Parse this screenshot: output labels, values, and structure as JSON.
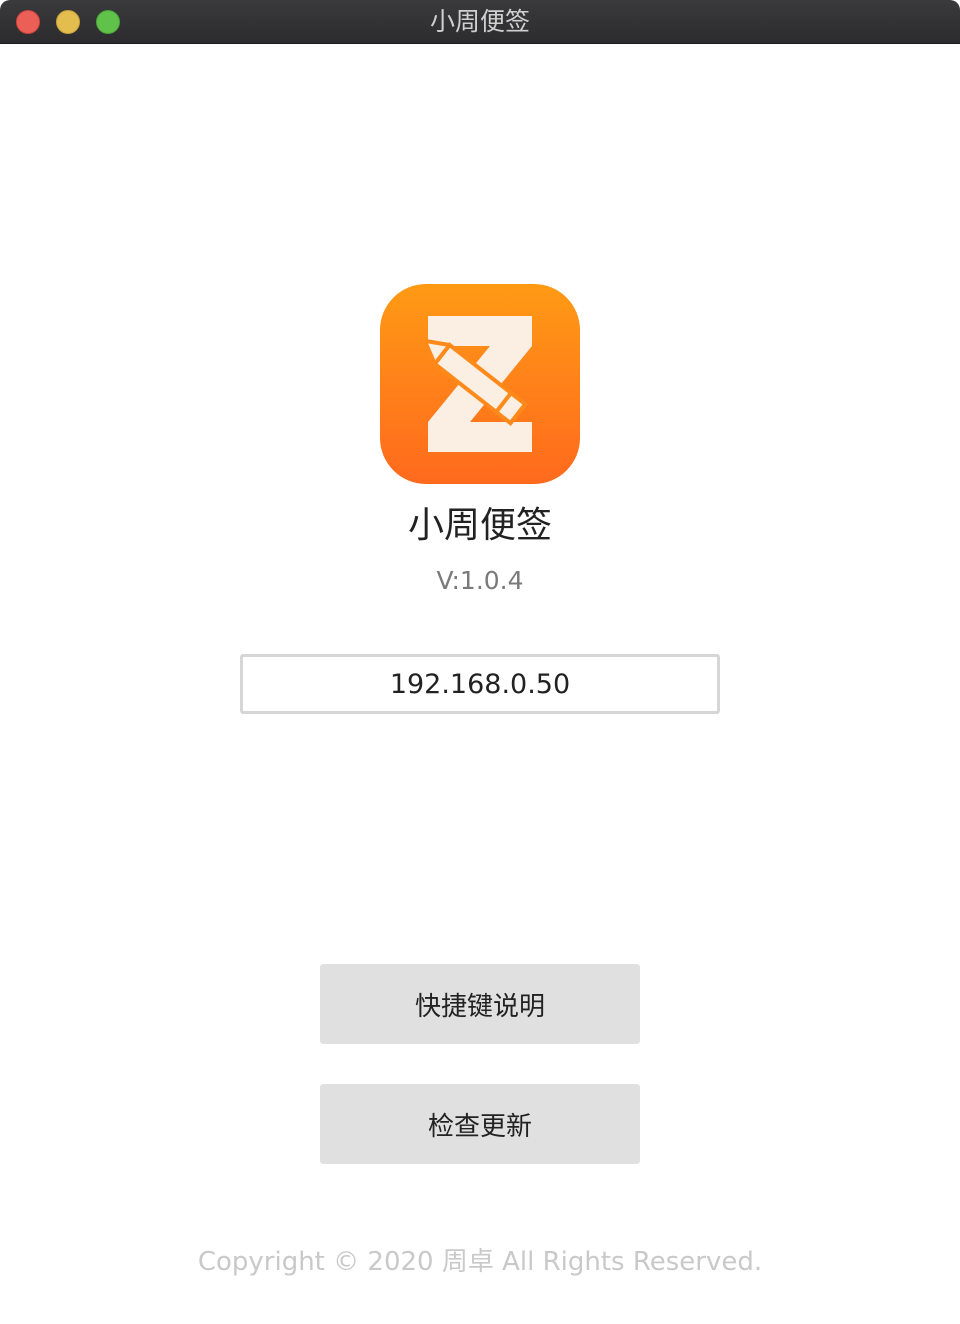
{
  "window": {
    "title": "小周便签",
    "controls": {
      "close_icon": "close-icon",
      "minimize_icon": "minimize-icon",
      "maximize_icon": "maximize-icon"
    }
  },
  "about": {
    "app_icon": "app-logo-z-pencil-icon",
    "app_name": "小周便签",
    "version": "V:1.0.4",
    "ip_value": "192.168.0.50",
    "shortcuts_button": "快捷键说明",
    "check_update_button": "检查更新",
    "copyright": "Copyright © 2020 周卓 All Rights Reserved."
  },
  "colors": {
    "icon_gradient_top": "#ff9a14",
    "icon_gradient_bottom": "#ff6a1c",
    "button_bg": "#e0e0e0",
    "titlebar_bg": "#2c2c2e"
  }
}
